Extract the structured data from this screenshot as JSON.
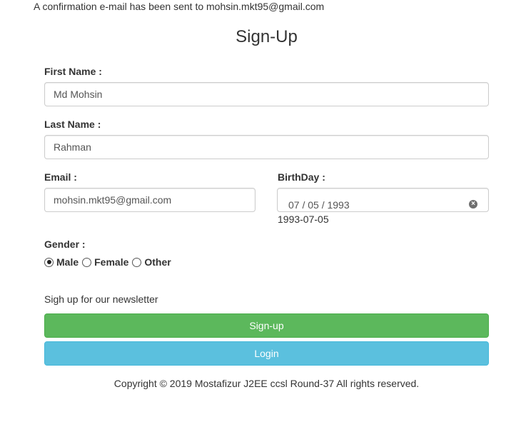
{
  "confirmation_message": "A confirmation e-mail has been sent to mohsin.mkt95@gmail.com",
  "title": "Sign-Up",
  "form": {
    "first_name": {
      "label": "First Name :",
      "value": "Md Mohsin"
    },
    "last_name": {
      "label": "Last Name :",
      "value": "Rahman"
    },
    "email": {
      "label": "Email :",
      "value": "mohsin.mkt95@gmail.com"
    },
    "birthday": {
      "label": "BirthDay :",
      "display_value": "07 / 05 / 1993",
      "raw_value": "1993-07-05",
      "clear_icon": "clear-circle-icon"
    },
    "gender": {
      "label": "Gender :",
      "options": [
        {
          "label": "Male",
          "checked": true
        },
        {
          "label": "Female",
          "checked": false
        },
        {
          "label": "Other",
          "checked": false
        }
      ]
    },
    "newsletter_text": "Sigh up for our newsletter",
    "signup_button": "Sign-up",
    "login_button": "Login"
  },
  "footer": "Copyright © 2019 Mostafizur J2EE ccsl Round-37 All rights reserved.",
  "colors": {
    "signup_button": "#5cb85c",
    "login_button": "#5bc0de"
  }
}
